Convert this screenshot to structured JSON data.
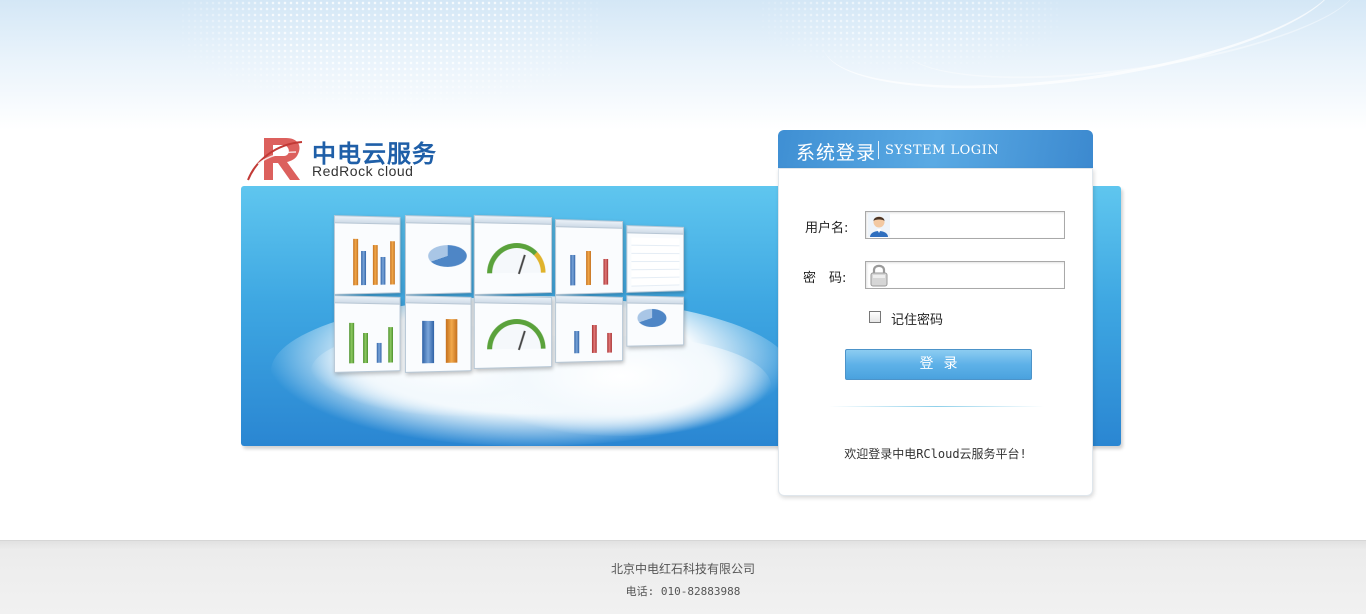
{
  "brand": {
    "name_cn": "中电云服务",
    "name_en": "RedRock cloud",
    "logo_icon": "redrock-r-logo",
    "color_primary": "#1f5fa8",
    "color_logo_mark": "#d9534f"
  },
  "login": {
    "title_cn": "系统登录",
    "title_en": "SYSTEM LOGIN",
    "username_label": "用户名:",
    "username_icon": "user-avatar-icon",
    "username_value": "",
    "password_label": "密　码:",
    "password_icon": "padlock-icon",
    "password_value": "",
    "remember_label": "记住密码",
    "remember_checked": false,
    "submit_label": "登录",
    "welcome_text": "欢迎登录中电RCloud云服务平台!"
  },
  "banner": {
    "illustration": "cloud-dashboard-illustration",
    "color_top": "#5fc6ef",
    "color_bottom": "#2a86d2"
  },
  "footer": {
    "company": "北京中电红石科技有限公司",
    "phone": "电话: 010-82883988"
  }
}
